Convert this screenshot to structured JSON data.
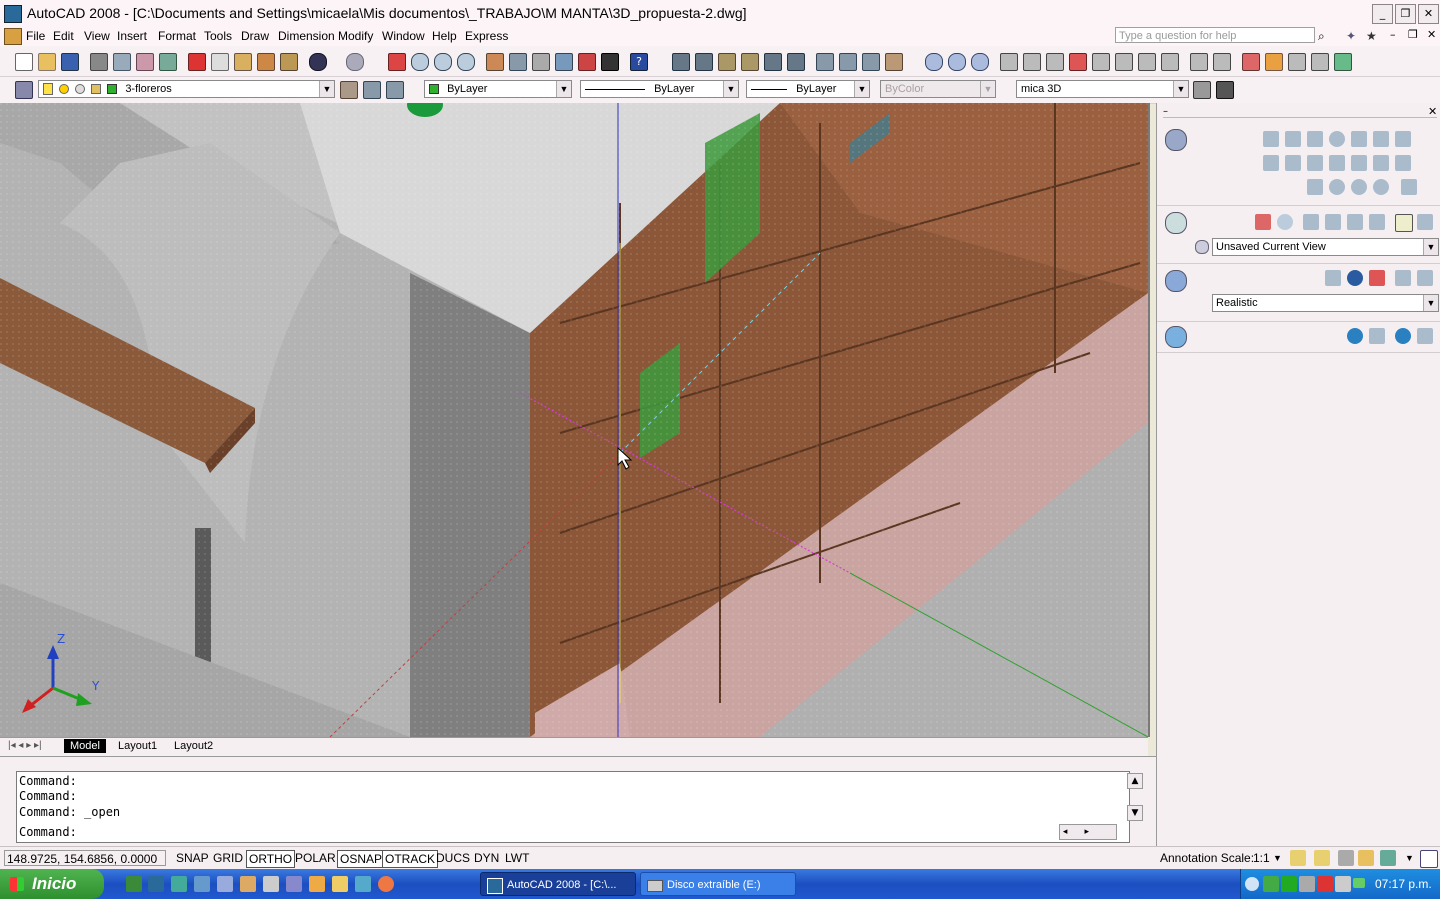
{
  "window": {
    "title": "AutoCAD 2008 - [C:\\Documents and Settings\\micaela\\Mis documentos\\_TRABAJO\\M MANTA\\3D_propuesta-2.dwg]",
    "minimize": "_",
    "restore": "❐",
    "close": "✕"
  },
  "menu": [
    "File",
    "Edit",
    "View",
    "Insert",
    "Format",
    "Tools",
    "Draw",
    "Dimension",
    "Modify",
    "Window",
    "Help",
    "Express"
  ],
  "help_search": {
    "placeholder": "Type a question for help"
  },
  "toolbar": {
    "layer": "3-floreros",
    "color": "ByLayer",
    "linetype": "ByLayer",
    "lineweight": "ByLayer",
    "plotstyle": "ByColor",
    "visual_style_name": "mica 3D"
  },
  "ucs": {
    "z": "Z",
    "y": "Y"
  },
  "tabs": [
    "Model",
    "Layout1",
    "Layout2"
  ],
  "command_lines": [
    "Command:",
    "Command:",
    "Command: _open",
    "Command:"
  ],
  "status": {
    "coords": "148.9725, 154.6856, 0.0000",
    "buttons": [
      "SNAP",
      "GRID",
      "ORTHO",
      "POLAR",
      "OSNAP",
      "OTRACK",
      "DUCS",
      "DYN",
      "LWT"
    ],
    "active": [
      "ORTHO",
      "OSNAP",
      "OTRACK"
    ],
    "annotation_label": "Annotation Scale:",
    "annotation_value": "1:1"
  },
  "panel": {
    "view_combo": "Unsaved Current View",
    "visual_style_combo": "Realistic"
  },
  "taskbar": {
    "start": "Inicio",
    "items": [
      "AutoCAD 2008 - [C:\\...",
      "Disco extraíble (E:)"
    ],
    "clock": "07:17 p.m."
  }
}
